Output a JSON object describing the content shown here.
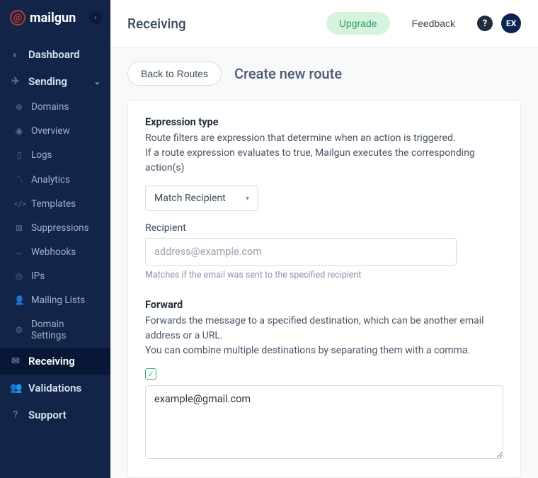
{
  "brand": {
    "name": "mailgun"
  },
  "sidebar": {
    "dashboard": "Dashboard",
    "sending": "Sending",
    "sub": {
      "domains": "Domains",
      "overview": "Overview",
      "logs": "Logs",
      "analytics": "Analytics",
      "templates": "Templates",
      "suppressions": "Suppressions",
      "webhooks": "Webhooks",
      "ips": "IPs",
      "mailing_lists": "Mailing Lists",
      "domain_settings": "Domain Settings"
    },
    "receiving": "Receiving",
    "validations": "Validations",
    "support": "Support"
  },
  "header": {
    "page_title": "Receiving",
    "upgrade": "Upgrade",
    "feedback": "Feedback",
    "avatar_initials": "EX"
  },
  "page": {
    "back_button": "Back to Routes",
    "content_title": "Create new route"
  },
  "form": {
    "expression": {
      "title": "Expression type",
      "desc_line1": "Route filters are expression that determine when an action is triggered.",
      "desc_line2": "If a route expression evaluates to true, Mailgun executes the corresponding action(s)",
      "selected": "Match Recipient",
      "recipient_label": "Recipient",
      "recipient_placeholder": "address@example.com",
      "recipient_helper": "Matches if the email was sent to the specified recipient"
    },
    "forward": {
      "title": "Forward",
      "desc_line1": "Forwards the message to a specified destination, which can be another email address or a URL.",
      "desc_line2": "You can combine multiple destinations by separating them with a comma.",
      "enabled": true,
      "value": "example@gmail.com"
    }
  }
}
